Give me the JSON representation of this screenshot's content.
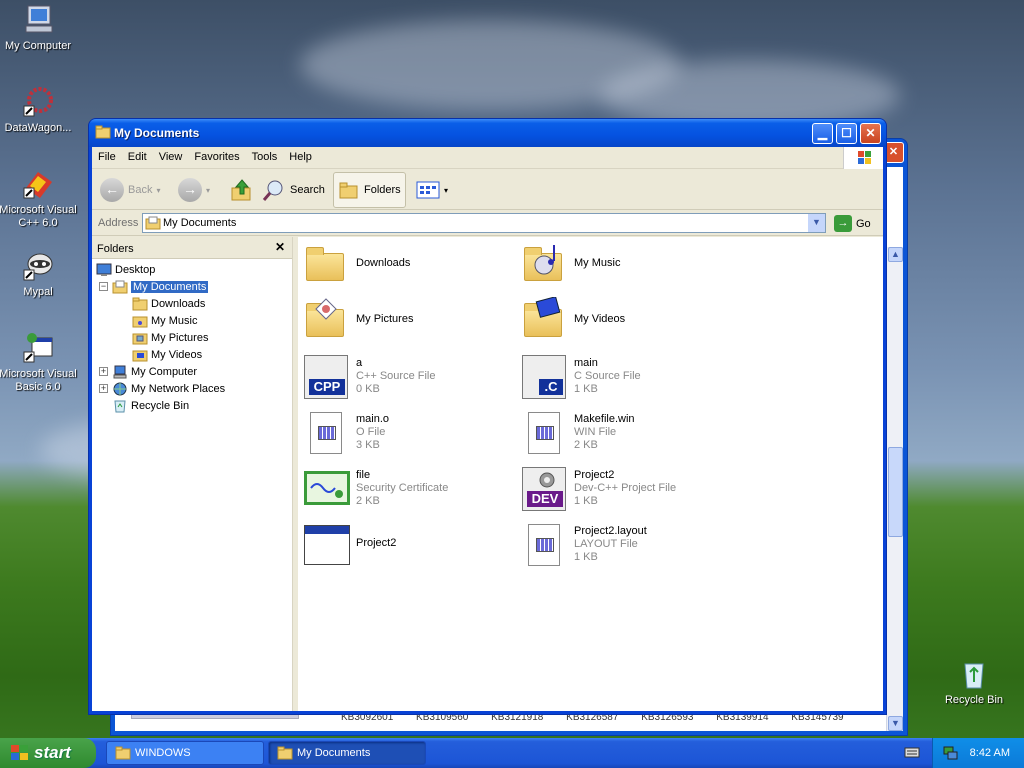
{
  "desktop": {
    "icons": [
      {
        "label": "My Computer",
        "icon": "my-computer-icon"
      },
      {
        "label": "DataWagon...",
        "icon": "datawagon-icon"
      },
      {
        "label": "Microsoft Visual C++ 6.0",
        "icon": "visual-cpp-icon"
      },
      {
        "label": "Mypal",
        "icon": "mypal-icon"
      },
      {
        "label": "Microsoft Visual Basic 6.0",
        "icon": "visual-basic-icon"
      },
      {
        "label": "Recycle Bin",
        "icon": "recycle-bin-icon"
      }
    ]
  },
  "background_window": {
    "bottom_text": "KB3092601 KB3109560 KB3121918 KB3126587 KB3126593 KB3139914 KB3145739"
  },
  "window": {
    "title": "My Documents",
    "menu": [
      "File",
      "Edit",
      "View",
      "Favorites",
      "Tools",
      "Help"
    ],
    "toolbar": {
      "back": "Back",
      "search": "Search",
      "folders": "Folders"
    },
    "address": {
      "label": "Address",
      "value": "My Documents",
      "go": "Go"
    },
    "folders_pane": {
      "title": "Folders",
      "tree": [
        {
          "label": "Desktop",
          "icon": "desktop-icon"
        },
        {
          "label": "My Documents",
          "icon": "my-documents-icon",
          "selected": true
        },
        {
          "label": "Downloads",
          "icon": "folder-icon"
        },
        {
          "label": "My Music",
          "icon": "my-music-icon"
        },
        {
          "label": "My Pictures",
          "icon": "my-pictures-icon"
        },
        {
          "label": "My Videos",
          "icon": "my-videos-icon"
        },
        {
          "label": "My Computer",
          "icon": "my-computer-icon"
        },
        {
          "label": "My Network Places",
          "icon": "network-places-icon"
        },
        {
          "label": "Recycle Bin",
          "icon": "recycle-bin-icon"
        }
      ]
    },
    "files": [
      {
        "name": "Downloads",
        "type": "",
        "size": "",
        "icon": "folder-icon"
      },
      {
        "name": "My Music",
        "type": "",
        "size": "",
        "icon": "my-music-folder-icon"
      },
      {
        "name": "My Pictures",
        "type": "",
        "size": "",
        "icon": "my-pictures-folder-icon"
      },
      {
        "name": "My Videos",
        "type": "",
        "size": "",
        "icon": "my-videos-folder-icon"
      },
      {
        "name": "a",
        "type": "C++ Source File",
        "size": "0 KB",
        "icon": "cpp-file-icon"
      },
      {
        "name": "main",
        "type": "C Source File",
        "size": "1 KB",
        "icon": "c-file-icon"
      },
      {
        "name": "main.o",
        "type": "O File",
        "size": "3 KB",
        "icon": "generic-file-icon"
      },
      {
        "name": "Makefile.win",
        "type": "WIN File",
        "size": "2 KB",
        "icon": "generic-file-icon"
      },
      {
        "name": "file",
        "type": "Security Certificate",
        "size": "2 KB",
        "icon": "certificate-icon"
      },
      {
        "name": "Project2",
        "type": "Dev-C++ Project File",
        "size": "1 KB",
        "icon": "dev-project-icon"
      },
      {
        "name": "Project2",
        "type": "",
        "size": "",
        "icon": "application-icon"
      },
      {
        "name": "Project2.layout",
        "type": "LAYOUT File",
        "size": "1 KB",
        "icon": "generic-file-icon"
      }
    ]
  },
  "taskbar": {
    "start": "start",
    "tasks": [
      {
        "label": "WINDOWS",
        "icon": "folder-icon"
      },
      {
        "label": "My Documents",
        "icon": "folder-icon"
      }
    ],
    "time": "8:42 AM"
  },
  "colors": {
    "titlebar": "#0a5ee8",
    "taskbar": "#245edb",
    "start": "#3c9b3c",
    "selection": "#316ac5"
  }
}
